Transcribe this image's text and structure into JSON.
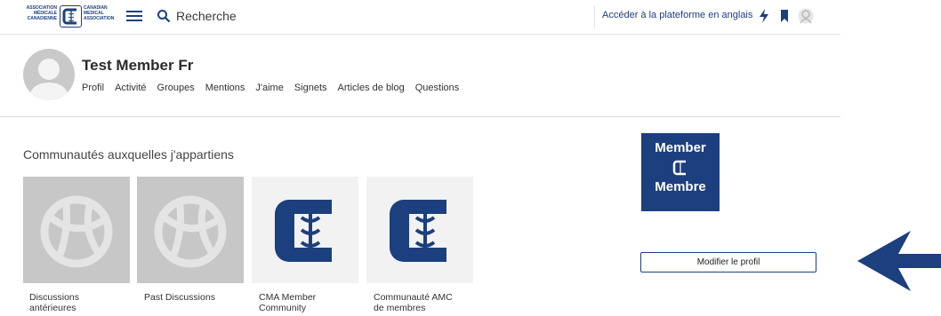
{
  "header": {
    "logo_left_lines": [
      "ASSOCIATION",
      "MÉDICALE",
      "CANADIENNE"
    ],
    "logo_right_lines": [
      "CANADIAN",
      "MEDICAL",
      "ASSOCIATION"
    ],
    "search_label": "Recherche",
    "lang_link": "Accéder à la plateforme en anglais",
    "icons": [
      "menu-icon",
      "search-icon",
      "lightning-icon",
      "bookmark-icon",
      "user-icon"
    ]
  },
  "profile": {
    "name": "Test Member Fr",
    "tabs": [
      "Profil",
      "Activité",
      "Groupes",
      "Mentions",
      "J'aime",
      "Signets",
      "Articles de blog",
      "Questions"
    ]
  },
  "communities": {
    "title": "Communautés auxquelles j'appartiens",
    "items": [
      {
        "label_lines": [
          "Discussions",
          "antérieures"
        ],
        "icon": "globe-icon"
      },
      {
        "label_lines": [
          "Past Discussions"
        ],
        "icon": "globe-icon"
      },
      {
        "label_lines": [
          "CMA Member",
          "Community"
        ],
        "icon": "cma-logo-icon"
      },
      {
        "label_lines": [
          "Communauté AMC",
          "de membres"
        ],
        "icon": "cma-logo-icon"
      }
    ]
  },
  "sidebar": {
    "badge_line1": "Member",
    "badge_line2": "Membre",
    "edit_button": "Modifier le profil"
  },
  "colors": {
    "brand": "#1c3f7e",
    "tile_gray": "#c7c7c7"
  }
}
